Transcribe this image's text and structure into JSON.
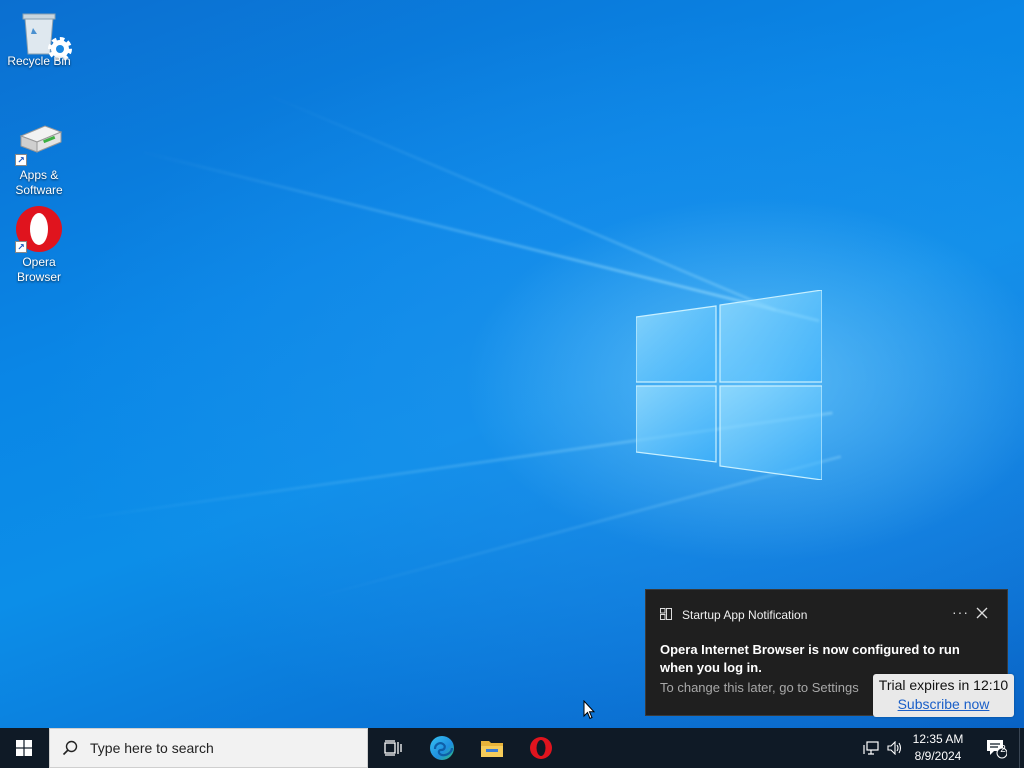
{
  "desktop": {
    "icons": [
      {
        "label": "Recycle Bin",
        "icon": "recycle-bin-icon"
      },
      {
        "label": "Apps &\nSoftware",
        "icon": "apps-software-icon"
      },
      {
        "label": "Opera\nBrowser",
        "icon": "opera-icon"
      }
    ]
  },
  "notification": {
    "header": "Startup App Notification",
    "more_label": "···",
    "message": "Opera Internet Browser is now configured to run when you log in.",
    "sub_text": "To change this later, go to Settings"
  },
  "trial": {
    "text": "Trial expires in 12:10",
    "link": "Subscribe now"
  },
  "taskbar": {
    "search_placeholder": "Type here to search",
    "pinned": [
      "task-view-icon",
      "edge-icon",
      "file-explorer-icon",
      "opera-icon"
    ],
    "clock_time": "12:35 AM",
    "clock_date": "8/9/2024",
    "notification_count": "2"
  },
  "colors": {
    "wallpaper": "#0a78d8",
    "taskbar": "#0f1a26",
    "toast_bg": "#1f1f1f",
    "opera_red": "#e0141e"
  }
}
